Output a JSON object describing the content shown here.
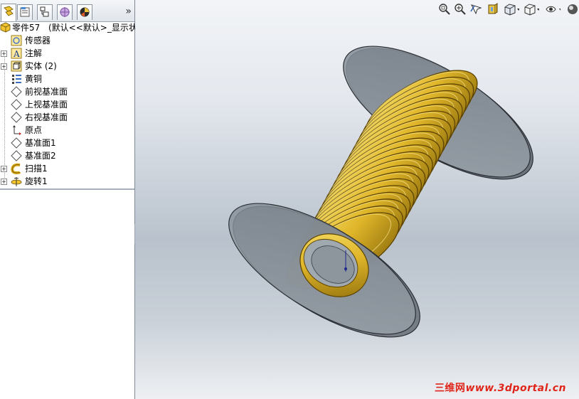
{
  "feature_tree": {
    "root": {
      "label": "零件57",
      "config": "(默认<<默认>_显示状态"
    },
    "items": [
      {
        "label": "传感器",
        "icon": "sensor-icon",
        "expandable": false
      },
      {
        "label": "注解",
        "icon": "annotation-icon",
        "expandable": true
      },
      {
        "label": "实体 (2)",
        "icon": "solid-bodies-icon",
        "expandable": true
      },
      {
        "label": "黄铜",
        "icon": "material-icon",
        "expandable": false
      },
      {
        "label": "前视基准面",
        "icon": "plane-icon",
        "expandable": false
      },
      {
        "label": "上视基准面",
        "icon": "plane-icon",
        "expandable": false
      },
      {
        "label": "右视基准面",
        "icon": "plane-icon",
        "expandable": false
      },
      {
        "label": "原点",
        "icon": "origin-icon",
        "expandable": false
      },
      {
        "label": "基准面1",
        "icon": "plane-icon",
        "expandable": false
      },
      {
        "label": "基准面2",
        "icon": "plane-icon",
        "expandable": false
      },
      {
        "label": "扫描1",
        "icon": "sweep-icon",
        "expandable": true
      },
      {
        "label": "旋转1",
        "icon": "revolve-icon",
        "expandable": true
      }
    ],
    "expand_symbol": "+",
    "more_tabs": "»"
  },
  "tabs": [
    "feature-manager-tab",
    "property-manager-tab",
    "configuration-manager-tab",
    "dimxpert-tab",
    "display-manager-tab"
  ],
  "view_toolbar": [
    "zoom-to-fit-icon",
    "zoom-area-icon",
    "previous-view-icon",
    "section-view-icon",
    "view-orientation-icon",
    "display-style-icon",
    "hide-show-icon",
    "appearance-icon"
  ],
  "watermark": {
    "brand": "三维网",
    "url": "www.3dportal.cn"
  },
  "colors": {
    "brass": "#e0b62a",
    "brass_dark": "#8a6a0a",
    "flange": "#8a939c",
    "viewport_top": "#f2f4f7"
  }
}
